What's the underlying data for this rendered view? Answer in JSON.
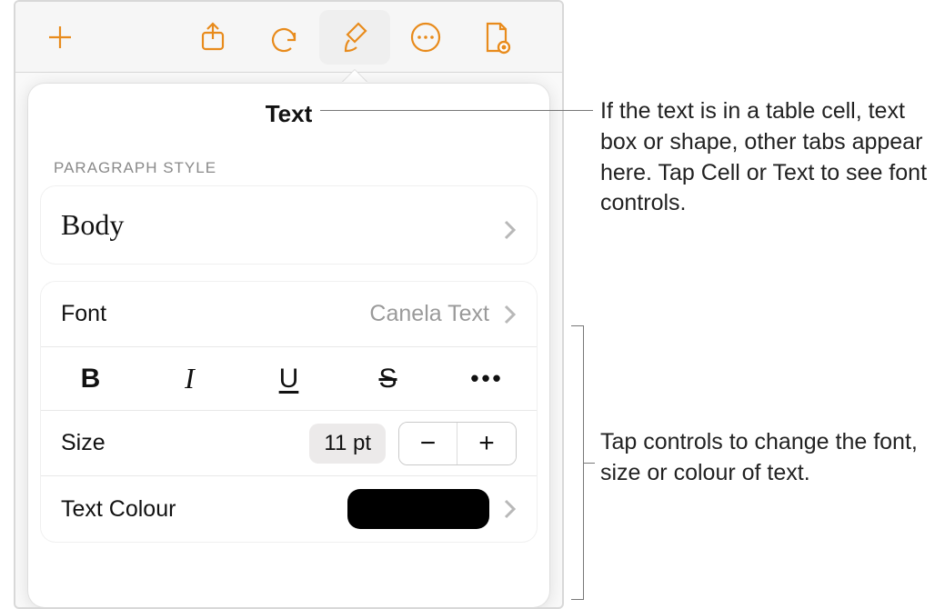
{
  "toolbar": {
    "icons": [
      "plus",
      "share",
      "undo",
      "brush",
      "more",
      "document"
    ]
  },
  "panel": {
    "title": "Text",
    "section_label": "Paragraph Style",
    "paragraph_style": "Body",
    "font_label": "Font",
    "font_value": "Canela Text",
    "style_buttons": {
      "bold": "B",
      "italic": "I",
      "underline": "U",
      "strike": "S",
      "more": "•••"
    },
    "size_label": "Size",
    "size_value": "11 pt",
    "stepper_minus": "−",
    "stepper_plus": "+",
    "colour_label": "Text Colour",
    "colour_hex": "#000000"
  },
  "callouts": {
    "top": "If the text is in a table cell, text box or shape, other tabs appear here. Tap Cell or Text to see font controls.",
    "bottom": "Tap controls to change the font, size or colour of text."
  }
}
